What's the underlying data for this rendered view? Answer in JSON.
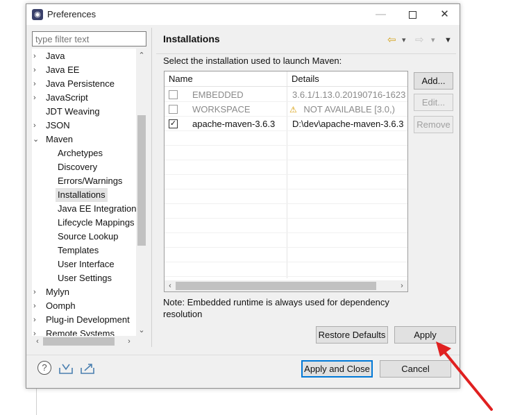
{
  "window": {
    "title": "Preferences",
    "controls": {
      "minimize": "—",
      "close": "✕"
    }
  },
  "filter": {
    "placeholder": "type filter text"
  },
  "tree": {
    "items": [
      {
        "label": "Java",
        "arrow": "›"
      },
      {
        "label": "Java EE",
        "arrow": "›"
      },
      {
        "label": "Java Persistence",
        "arrow": "›"
      },
      {
        "label": "JavaScript",
        "arrow": "›"
      },
      {
        "label": "JDT Weaving",
        "arrow": ""
      },
      {
        "label": "JSON",
        "arrow": "›"
      },
      {
        "label": "Maven",
        "arrow": "⌄"
      },
      {
        "label": "Archetypes"
      },
      {
        "label": "Discovery"
      },
      {
        "label": "Errors/Warnings"
      },
      {
        "label": "Installations"
      },
      {
        "label": "Java EE Integration"
      },
      {
        "label": "Lifecycle Mappings"
      },
      {
        "label": "Source Lookup"
      },
      {
        "label": "Templates"
      },
      {
        "label": "User Interface"
      },
      {
        "label": "User Settings"
      },
      {
        "label": "Mylyn",
        "arrow": "›"
      },
      {
        "label": "Oomph",
        "arrow": "›"
      },
      {
        "label": "Plug-in Development",
        "arrow": "›"
      },
      {
        "label": "Remote Systems",
        "arrow": "›"
      }
    ],
    "selected": "Installations",
    "scroll_arrows": {
      "up": "⌃",
      "down": "⌄",
      "left": "‹",
      "right": "›"
    }
  },
  "page": {
    "title": "Installations",
    "prompt": "Select the installation used to launch Maven:",
    "nav": {
      "back": "⇦",
      "forward": "⇨",
      "dropdown": "▾",
      "menu": "▼"
    }
  },
  "table": {
    "columns": [
      "Name",
      "Details"
    ],
    "rows": [
      {
        "checked": false,
        "name": "EMBEDDED",
        "details": "3.6.1/1.13.0.20190716-1623",
        "dimmed": true
      },
      {
        "checked": false,
        "name": "WORKSPACE",
        "details": "NOT AVAILABLE [3.0,)",
        "dimmed": true,
        "warning": "⚠"
      },
      {
        "checked": true,
        "name": "apache-maven-3.6.3",
        "details": "D:\\dev\\apache-maven-3.6.3",
        "dimmed": false
      }
    ],
    "check_mark": "✓",
    "scroll_arrows": {
      "left": "‹",
      "right": "›"
    }
  },
  "side_buttons": {
    "add": "Add...",
    "edit": "Edit...",
    "remove": "Remove"
  },
  "note": "Note: Embedded runtime is always used for dependency resolution",
  "buttons": {
    "restore_defaults": "Restore Defaults",
    "apply": "Apply",
    "apply_and_close": "Apply and Close",
    "cancel": "Cancel"
  },
  "footer_icons": {
    "help": "?"
  },
  "colors": {
    "annotation_arrow": "#e02020",
    "default_button_border": "#0078d7"
  }
}
